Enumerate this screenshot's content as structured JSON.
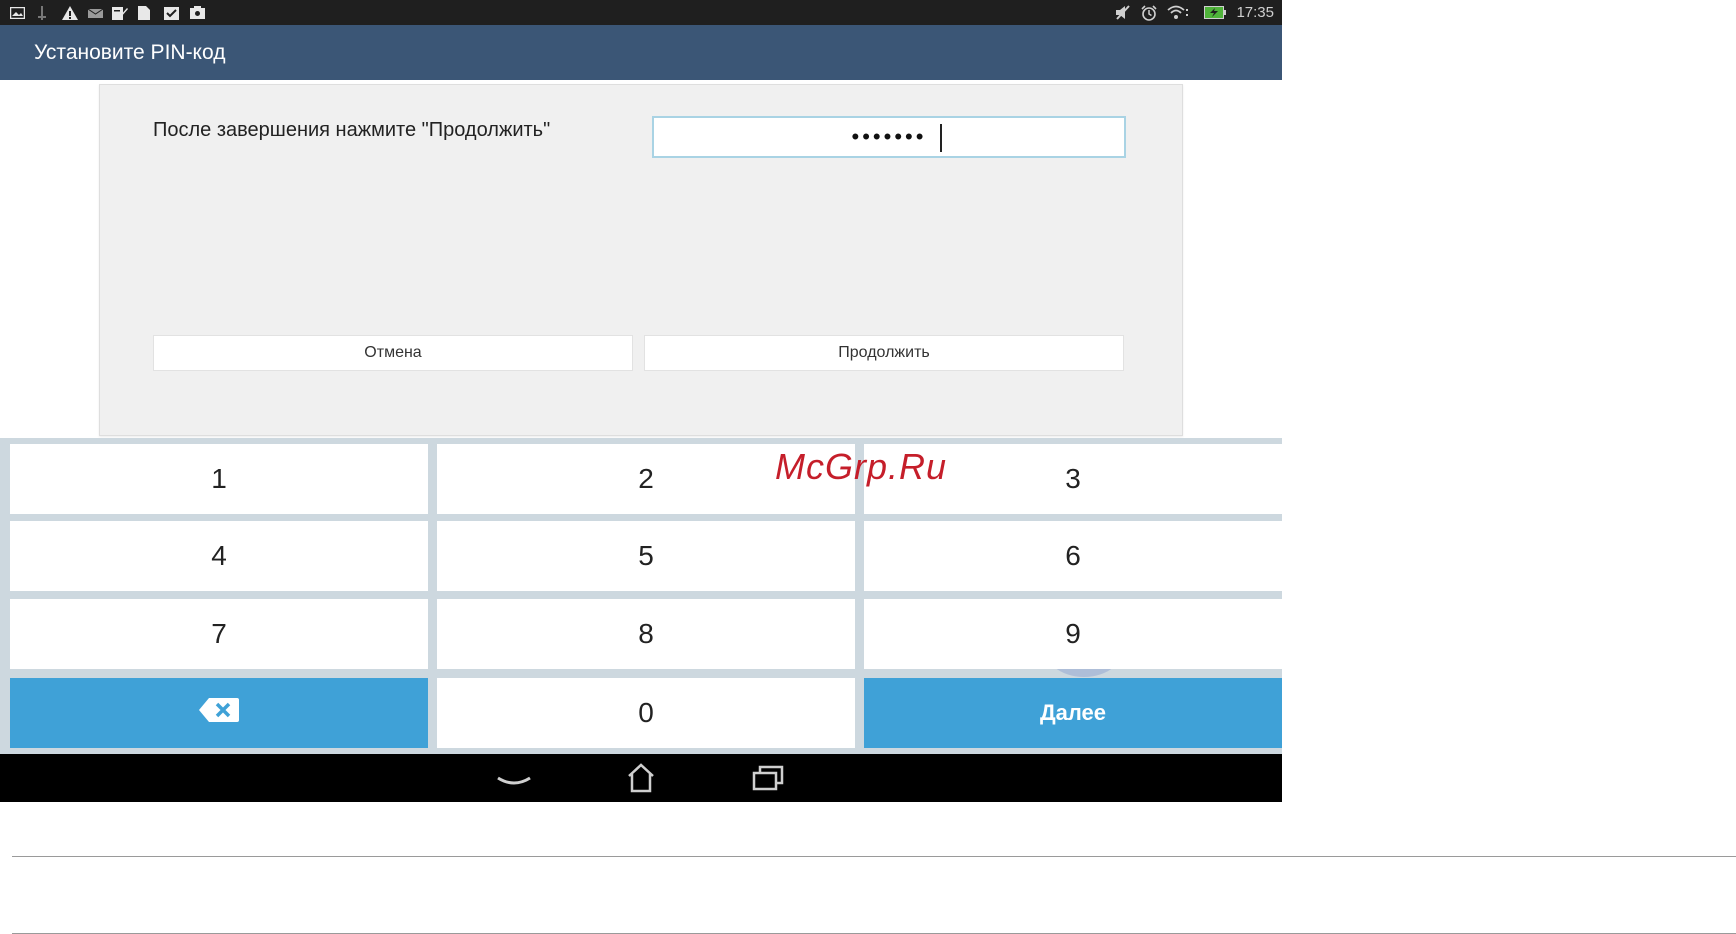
{
  "status_bar": {
    "time": "17:35",
    "left_icons": [
      "photo-icon",
      "usb-icon",
      "warning-icon",
      "mail-icon",
      "edit-icon",
      "file-icon",
      "check-calendar-icon",
      "camera-icon"
    ],
    "right_icons": [
      "mute-icon",
      "alarm-icon",
      "wifi-icon",
      "battery-charging-icon"
    ]
  },
  "action_bar": {
    "title": "Установите PIN-код"
  },
  "dialog": {
    "prompt": "После завершения нажмите \"Продолжить\"",
    "pin_masked": "•••••••",
    "cancel_label": "Отмена",
    "continue_label": "Продолжить"
  },
  "keypad": {
    "keys": [
      "1",
      "2",
      "3",
      "4",
      "5",
      "6",
      "7",
      "8",
      "9",
      "0"
    ],
    "next_label": "Далее",
    "backspace_icon": "backspace-icon",
    "pressed_key": "5"
  },
  "nav_bar": {
    "icons": [
      "back-icon",
      "home-icon",
      "recents-icon"
    ]
  },
  "watermark": "McGrp.Ru",
  "colors": {
    "action_bar": "#3b5676",
    "key_accent": "#3fa1d7",
    "watermark": "#c51e2a"
  }
}
